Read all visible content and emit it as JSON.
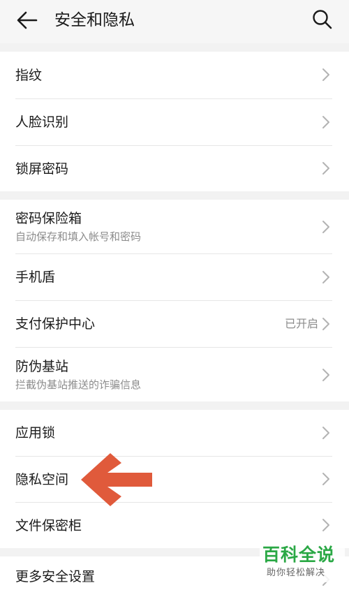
{
  "header": {
    "back_icon": "arrow-left-icon",
    "title": "安全和隐私",
    "search_icon": "search-icon"
  },
  "groups": [
    {
      "items": [
        {
          "title": "指纹",
          "subtitle": "",
          "value": ""
        },
        {
          "title": "人脸识别",
          "subtitle": "",
          "value": ""
        },
        {
          "title": "锁屏密码",
          "subtitle": "",
          "value": ""
        }
      ]
    },
    {
      "items": [
        {
          "title": "密码保险箱",
          "subtitle": "自动保存和填入帐号和密码",
          "value": ""
        },
        {
          "title": "手机盾",
          "subtitle": "",
          "value": ""
        },
        {
          "title": "支付保护中心",
          "subtitle": "",
          "value": "已开启"
        },
        {
          "title": "防伪基站",
          "subtitle": "拦截伪基站推送的诈骗信息",
          "value": ""
        }
      ]
    },
    {
      "items": [
        {
          "title": "应用锁",
          "subtitle": "",
          "value": ""
        },
        {
          "title": "隐私空间",
          "subtitle": "",
          "value": ""
        },
        {
          "title": "文件保密柜",
          "subtitle": "",
          "value": ""
        }
      ]
    },
    {
      "items": [
        {
          "title": "更多安全设置",
          "subtitle": "",
          "value": ""
        }
      ]
    }
  ],
  "annotation": {
    "arrow_color": "#e05a3b",
    "points_to": "隐私空间"
  },
  "watermark": {
    "title": "百科全说",
    "subtitle": "助你轻松解决"
  },
  "colors": {
    "header_bg": "#f6f6f6",
    "section_gap": "#f2f2f2",
    "secondary_text": "#8c8c8c",
    "watermark_green": "#2aa845"
  }
}
